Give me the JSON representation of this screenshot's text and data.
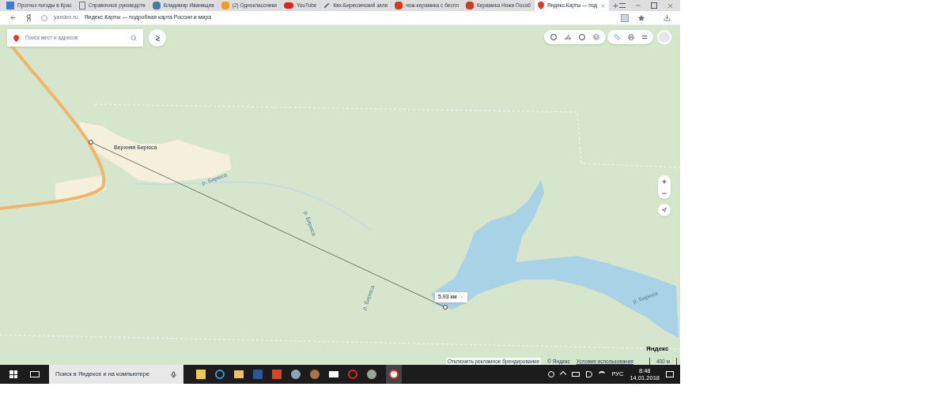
{
  "browser": {
    "tabs": [
      {
        "title": "Прогноз погоды в Крас",
        "selected": false
      },
      {
        "title": "Справочное руководств",
        "selected": false
      },
      {
        "title": "Владимир Иванищев",
        "selected": false
      },
      {
        "title": "(2) Одноклассники",
        "selected": false
      },
      {
        "title": "YouTube",
        "selected": false
      },
      {
        "title": "Квх-Бирюсинский зали",
        "selected": false
      },
      {
        "title": "нож-керамика с беспл",
        "selected": false
      },
      {
        "title": "Керамика Ножи Пособ",
        "selected": false
      },
      {
        "title": "Яндекс.Карты — под",
        "selected": true
      }
    ],
    "address": {
      "domain": "yandex.ru",
      "page_title": "Яндекс.Карты — подробная карта России и мира"
    }
  },
  "map": {
    "search": {
      "placeholder": "Поиск мест и адресов"
    },
    "labels": [
      "Верхняя Бирюса",
      "р. Бирюса",
      "р. Бирюса",
      "р. Бирюса",
      "р. Бирюса"
    ],
    "measurement": {
      "distance": "5.93 км"
    },
    "logo": "Яндекс",
    "footer": {
      "ad_link": "Отключить рекламное брендирование",
      "copyright": "© Яндекс",
      "terms": "Условия использования",
      "scale": "400 м"
    }
  },
  "taskbar": {
    "search": {
      "placeholder": "Поиск в Яндексе и на компьютере"
    },
    "language": "РУС",
    "time": "8:48",
    "date": "14.01.2018"
  }
}
